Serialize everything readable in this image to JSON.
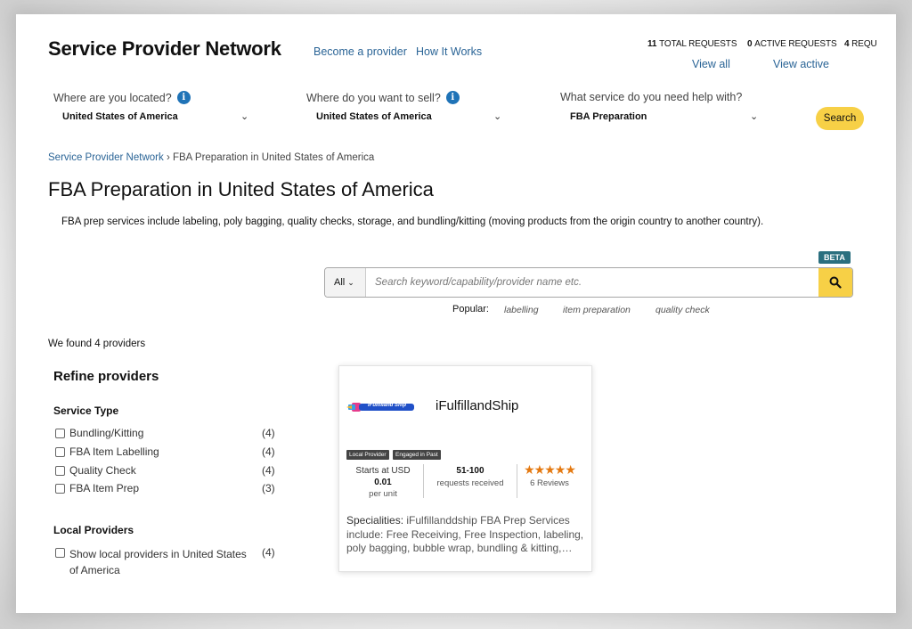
{
  "header": {
    "brand": "Service Provider Network",
    "nav": [
      "Become a provider",
      "How It Works"
    ],
    "requests": [
      {
        "count": "11",
        "label": "TOTAL REQUESTS",
        "link": "View all"
      },
      {
        "count": "0",
        "label": "ACTIVE REQUESTS",
        "link": "View active"
      },
      {
        "count": "4",
        "label": "REQU"
      }
    ]
  },
  "selectors": [
    {
      "label": "Where are you located?",
      "value": "United States of America",
      "info": true
    },
    {
      "label": "Where do you want to sell?",
      "value": "United States of America",
      "info": true
    },
    {
      "label": "What service do you need help with?",
      "value": "FBA Preparation",
      "info": false
    }
  ],
  "search_button": "Search",
  "breadcrumb": {
    "root": "Service Provider Network",
    "separator": "›",
    "current": "FBA Preparation in United States of America"
  },
  "page_title": "FBA Preparation in United States of America",
  "description": "FBA prep services include labeling, poly bagging, quality checks, storage, and bundling/kitting (moving products from the origin country to another country).",
  "search": {
    "badge": "BETA",
    "category": "All",
    "placeholder": "Search keyword/capability/provider name etc.",
    "popular_label": "Popular:",
    "popular": [
      "labelling",
      "item preparation",
      "quality check"
    ]
  },
  "results_text": "We found 4 providers",
  "refine": {
    "title": "Refine providers",
    "service_type": {
      "title": "Service Type",
      "options": [
        {
          "label": "Bundling/Kitting",
          "count": "(4)"
        },
        {
          "label": "FBA Item Labelling",
          "count": "(4)"
        },
        {
          "label": "Quality Check",
          "count": "(4)"
        },
        {
          "label": "FBA Item Prep",
          "count": "(3)"
        }
      ]
    },
    "local": {
      "title": "Local Providers",
      "option_line1": "Show local providers in United States",
      "option_line2": "of America",
      "count": "(4)"
    }
  },
  "provider": {
    "logo_text": "iFulfilland Ship",
    "name": "iFulfillandShip",
    "tags": [
      "Local Provider",
      "Engaged in Past"
    ],
    "price_line1": "Starts at USD",
    "price_value": "0.01",
    "price_unit": "per unit",
    "requests_value": "51-100",
    "requests_label": "requests received",
    "rating": 5,
    "reviews": "6 Reviews",
    "spec_label": "Specialities:",
    "spec_text": "iFulfillanddship FBA Prep Services include: Free Receiving, Free Inspection, labeling, poly bagging, bubble wrap, bundling & kitting,…"
  },
  "colors": {
    "link": "#2a6496",
    "accent_yellow": "#f7d046",
    "star": "#e47911",
    "info": "#1f73b7",
    "beta": "#2a6f7f"
  }
}
